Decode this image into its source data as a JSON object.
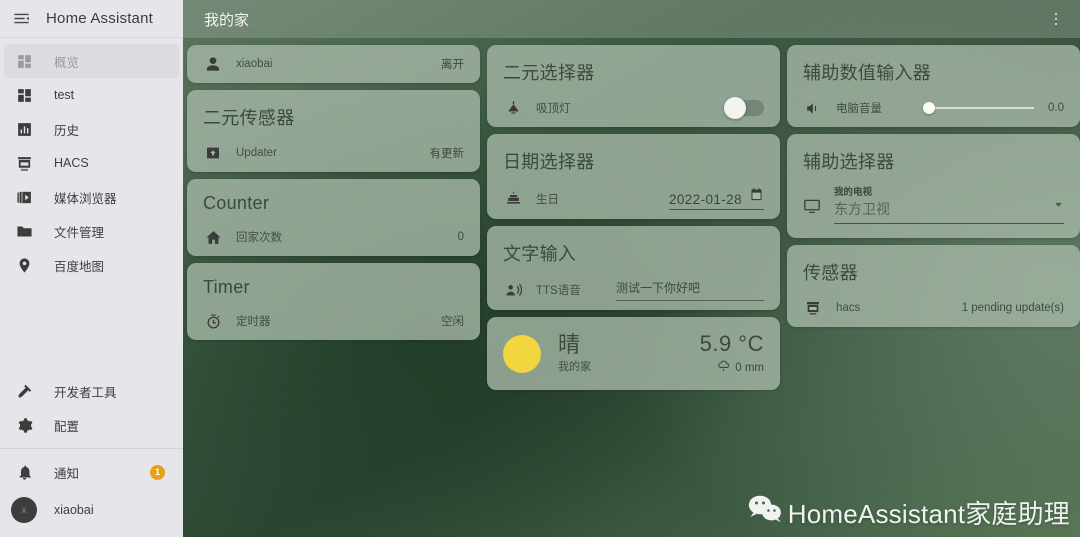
{
  "sidebar": {
    "title": "Home Assistant",
    "menu_icon": "menu-collapse-icon",
    "items": [
      {
        "label": "概览",
        "icon": "view-dashboard-icon",
        "active": true
      },
      {
        "label": "test",
        "icon": "view-dashboard-icon",
        "active": false
      },
      {
        "label": "历史",
        "icon": "chart-box-icon",
        "active": false
      },
      {
        "label": "HACS",
        "icon": "hacs-storefront-icon",
        "active": false
      },
      {
        "label": "媒体浏览器",
        "icon": "play-box-multiple-icon",
        "active": false
      },
      {
        "label": "文件管理",
        "icon": "folder-icon",
        "active": false
      },
      {
        "label": "百度地图",
        "icon": "map-marker-icon",
        "active": false
      }
    ],
    "tools": [
      {
        "label": "开发者工具",
        "icon": "hammer-icon"
      },
      {
        "label": "配置",
        "icon": "cog-icon"
      }
    ],
    "notifications": {
      "label": "通知",
      "icon": "bell-icon",
      "badge": "1"
    },
    "user": {
      "label": "xiaobai",
      "avatar_initial": "x"
    }
  },
  "topbar": {
    "title": "我的家",
    "overflow_icon": "dots-vertical-icon"
  },
  "columns": [
    {
      "cards": [
        {
          "title": null,
          "rows": [
            {
              "icon": "account-icon",
              "name": "xiaobai",
              "value": "离开",
              "kind": "text"
            }
          ]
        },
        {
          "title": "二元传感器",
          "rows": [
            {
              "icon": "package-up-icon",
              "name": "Updater",
              "value": "有更新",
              "kind": "text"
            }
          ]
        },
        {
          "title": "Counter",
          "rows": [
            {
              "icon": "home-icon",
              "name": "回家次数",
              "value": "0",
              "kind": "text"
            }
          ]
        },
        {
          "title": "Timer",
          "rows": [
            {
              "icon": "timer-icon",
              "name": "定时器",
              "value": "空闲",
              "kind": "text"
            }
          ]
        }
      ]
    },
    {
      "cards": [
        {
          "title": "二元选择器",
          "rows": [
            {
              "icon": "ceiling-light-icon",
              "name": "吸顶灯",
              "value": "",
              "kind": "toggle",
              "toggle_on": false
            }
          ]
        },
        {
          "title": "日期选择器",
          "rows": [
            {
              "icon": "cake-icon",
              "name": "生日",
              "value": "2022-01-28",
              "kind": "date"
            }
          ]
        },
        {
          "title": "文字输入",
          "rows": [
            {
              "icon": "account-voice-icon",
              "name": "TTS语音",
              "value": "测试一下你好吧",
              "kind": "text-input"
            }
          ]
        },
        {
          "title": null,
          "kind": "weather",
          "weather": {
            "icon": "sunny-icon",
            "condition": "晴",
            "location": "我的家",
            "temperature": "5.9 °C",
            "precip_icon": "weather-pouring-icon",
            "precipitation": "0 mm"
          }
        }
      ]
    },
    {
      "cards": [
        {
          "title": "辅助数值输入器",
          "rows": [
            {
              "icon": "volume-medium-icon",
              "name": "电脑音量",
              "value": "0.0",
              "kind": "slider",
              "slider_pct": 0
            }
          ]
        },
        {
          "title": "辅助选择器",
          "kind": "select",
          "select": {
            "icon": "television-icon",
            "label": "我的电视",
            "value": "东方卫视",
            "caret_icon": "chevron-down-icon"
          }
        },
        {
          "title": "传感器",
          "rows": [
            {
              "icon": "hacs-storefront-icon",
              "name": "hacs",
              "value": "1 pending update(s)",
              "kind": "text"
            }
          ]
        }
      ]
    }
  ],
  "watermark": {
    "icon": "wechat-icon",
    "text": "HomeAssistant家庭助理"
  },
  "colors": {
    "sidebar_bg": "#e6e6ea",
    "card_bg": "rgba(166,184,168,.80)",
    "badge": "#e5a117",
    "sun": "#f2d63f",
    "bg_green_dark": "#2c4632",
    "bg_green_light": "#5c7660"
  }
}
